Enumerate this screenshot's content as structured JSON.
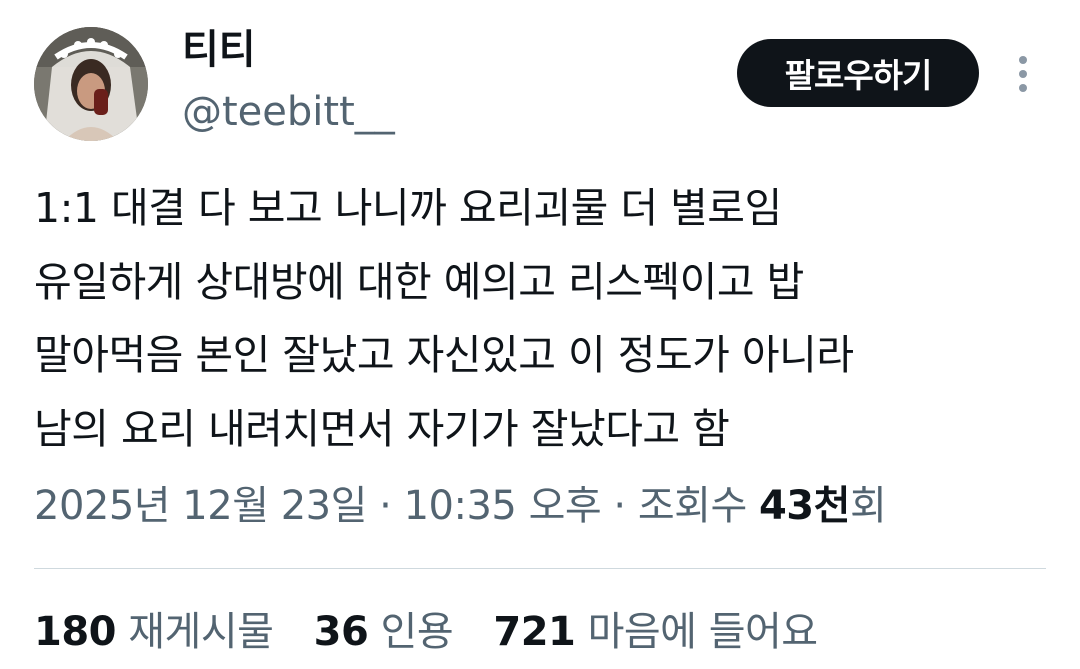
{
  "author": {
    "display_name": "티티",
    "handle": "@teebitt__",
    "avatar": "profile-photo"
  },
  "follow_button": {
    "label": "팔로우하기"
  },
  "more_icon": "more-vertical-icon",
  "tweet": {
    "lines": [
      "1:1 대결 다 보고 나니까 요리괴물 더 별로임",
      "유일하게 상대방에 대한 예의고 리스펙이고 밥",
      "말아먹음 본인 잘났고 자신있고 이 정도가 아니라",
      "남의 요리 내려치면서 자기가 잘났다고 함"
    ]
  },
  "meta": {
    "date": "2025년 12월 23일",
    "separator": " · ",
    "time": "10:35 오후",
    "views_label": "조회수 ",
    "views_count": "43천",
    "views_suffix": "회"
  },
  "stats": [
    {
      "count": "180",
      "label": "재게시물"
    },
    {
      "count": "36",
      "label": "인용"
    },
    {
      "count": "721",
      "label": "마음에 들어요"
    }
  ],
  "colors": {
    "text_primary": "#0f1419",
    "text_secondary": "#536471",
    "button_bg": "#0f1419",
    "button_text": "#ffffff",
    "divider": "#cfd9de"
  }
}
